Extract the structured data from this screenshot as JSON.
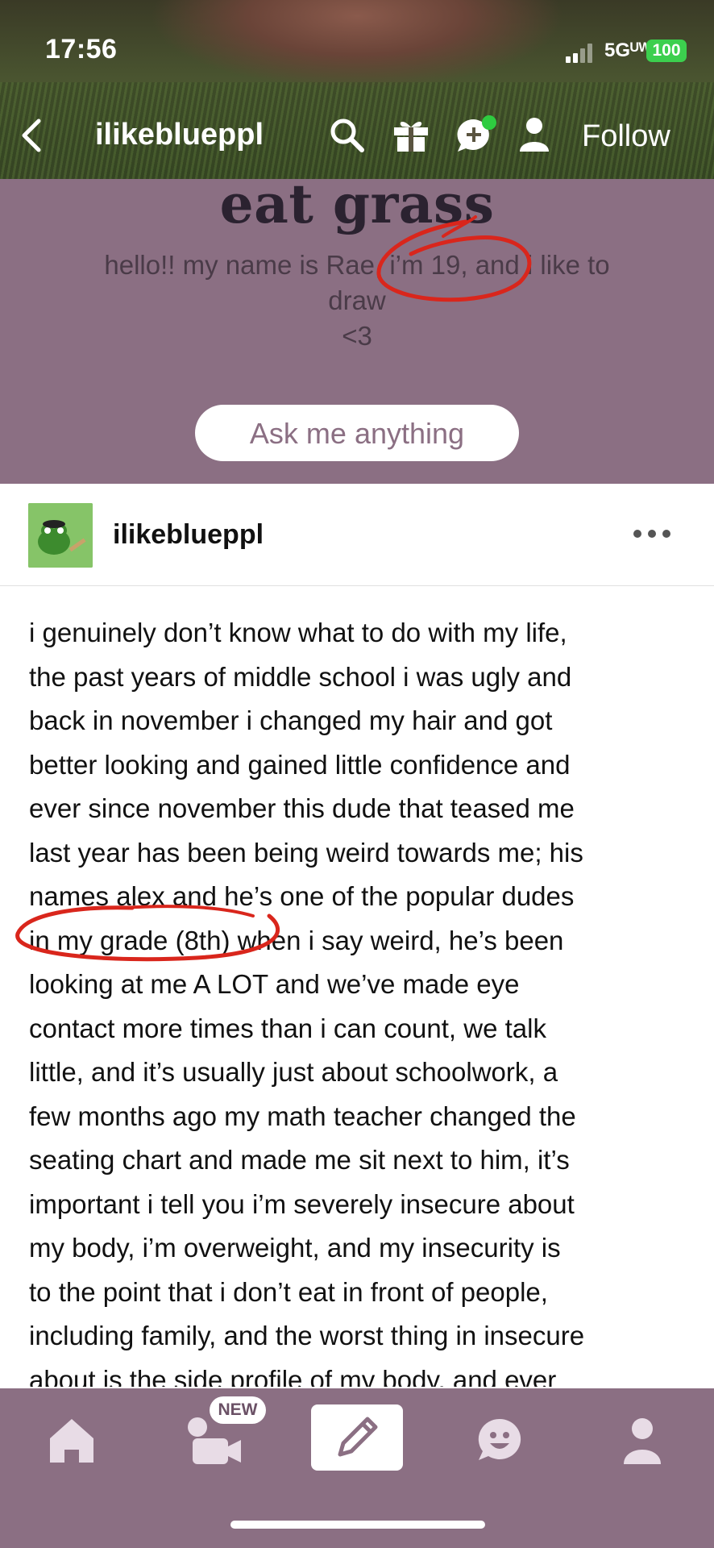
{
  "status_bar": {
    "time": "17:56",
    "network": "5Gᵁᵂ",
    "battery": "100",
    "battery_color": "#3ccf4e"
  },
  "nav": {
    "blog_name": "ilikeblueppl",
    "follow_label": "Follow",
    "icons": [
      "back-icon",
      "search-icon",
      "gift-icon",
      "chat-icon",
      "user-icon"
    ],
    "chat_badge_color": "#2ecc40"
  },
  "blog": {
    "title": "eat grass",
    "description_line1": "hello!! my name is Rae, i’m 19, and i like to",
    "description_line2": "draw",
    "description_line3": "<3",
    "ask_label": "Ask me anything",
    "header_color": "#8b6f83"
  },
  "post": {
    "author": "ilikeblueppl",
    "body_lines": [
      "i genuinely don’t know what to do with my life,",
      "the past years of middle school i was ugly and",
      "back in november i changed my hair and got",
      "better looking and gained little confidence and",
      "ever since november this dude that teased me",
      "last year has been being weird towards me; his",
      "names alex and he’s one of the popular dudes",
      "in my grade (8th) when i say weird, he’s been",
      "looking at me A LOT and we’ve made eye",
      "contact more times than i can count, we talk",
      "little, and it’s usually just about schoolwork, a",
      "few months ago my math teacher changed the",
      "seating chart and made me sit next to him, it’s",
      "important i tell you i’m severely insecure about",
      "my body, i’m overweight, and my insecurity is",
      "to the point that i don’t eat in front of people,",
      "including family, and the worst thing in insecure",
      "about is the side profile of my body, and ever"
    ]
  },
  "tab_bar": {
    "new_badge": "NEW",
    "tabs": [
      "home-icon",
      "video-icon",
      "compose-icon",
      "activity-icon",
      "account-icon"
    ]
  },
  "annotation_color": "#d9261c"
}
